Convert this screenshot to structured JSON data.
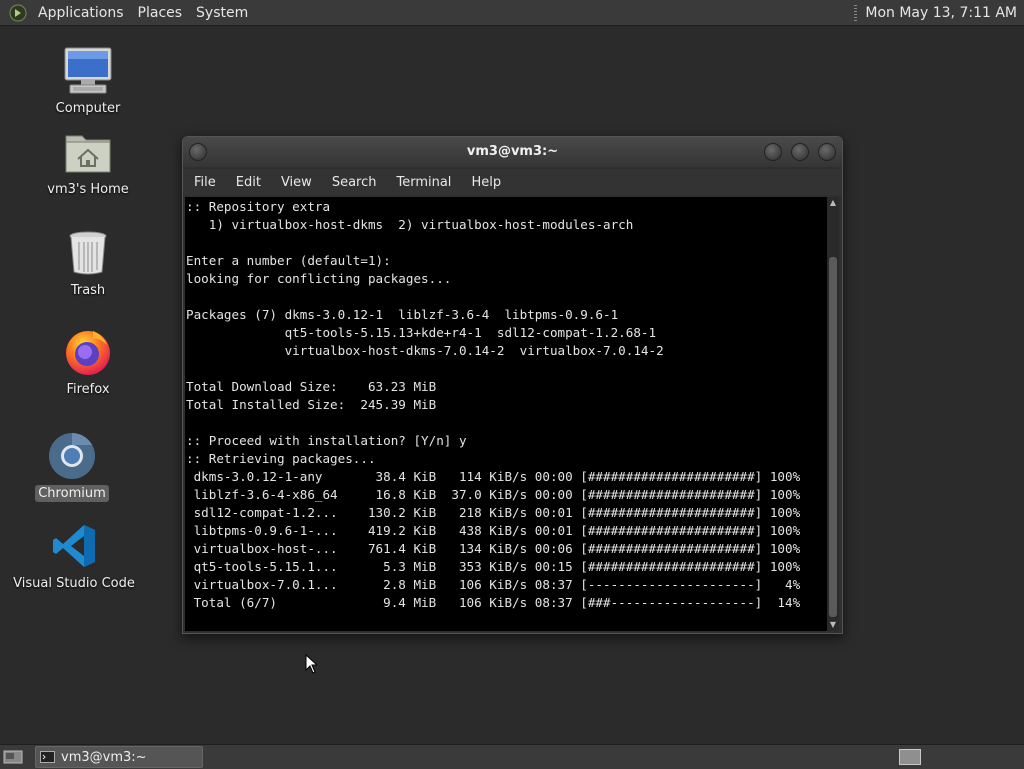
{
  "top_panel": {
    "menus": [
      "Applications",
      "Places",
      "System"
    ],
    "clock": "Mon May 13,  7:11 AM"
  },
  "desktop_icons": [
    {
      "label": "Computer",
      "icon": "computer-icon"
    },
    {
      "label": "vm3's Home",
      "icon": "home-folder-icon"
    },
    {
      "label": "Trash",
      "icon": "trash-icon"
    },
    {
      "label": "Firefox",
      "icon": "firefox-icon"
    },
    {
      "label": "Chromium",
      "icon": "chromium-icon",
      "selected": true
    },
    {
      "label": "Visual Studio Code",
      "icon": "vscode-icon"
    }
  ],
  "terminal": {
    "title": "vm3@vm3:~",
    "menu": [
      "File",
      "Edit",
      "View",
      "Search",
      "Terminal",
      "Help"
    ],
    "lines": [
      ":: Repository extra",
      "   1) virtualbox-host-dkms  2) virtualbox-host-modules-arch",
      "",
      "Enter a number (default=1):",
      "looking for conflicting packages...",
      "",
      "Packages (7) dkms-3.0.12-1  liblzf-3.6-4  libtpms-0.9.6-1",
      "             qt5-tools-5.15.13+kde+r4-1  sdl12-compat-1.2.68-1",
      "             virtualbox-host-dkms-7.0.14-2  virtualbox-7.0.14-2",
      "",
      "Total Download Size:    63.23 MiB",
      "Total Installed Size:  245.39 MiB",
      "",
      ":: Proceed with installation? [Y/n] y",
      ":: Retrieving packages...",
      " dkms-3.0.12-1-any       38.4 KiB   114 KiB/s 00:00 [######################] 100%",
      " liblzf-3.6-4-x86_64     16.8 KiB  37.0 KiB/s 00:00 [######################] 100%",
      " sdl12-compat-1.2...    130.2 KiB   218 KiB/s 00:01 [######################] 100%",
      " libtpms-0.9.6-1-...    419.2 KiB   438 KiB/s 00:01 [######################] 100%",
      " virtualbox-host-...    761.4 KiB   134 KiB/s 00:06 [######################] 100%",
      " qt5-tools-5.15.1...      5.3 MiB   353 KiB/s 00:15 [######################] 100%",
      " virtualbox-7.0.1...      2.8 MiB   106 KiB/s 08:37 [----------------------]   4%",
      " Total (6/7)              9.4 MiB   106 KiB/s 08:37 [###-------------------]  14%"
    ]
  },
  "taskbar": {
    "tasks": [
      {
        "label": "vm3@vm3:~"
      }
    ]
  }
}
